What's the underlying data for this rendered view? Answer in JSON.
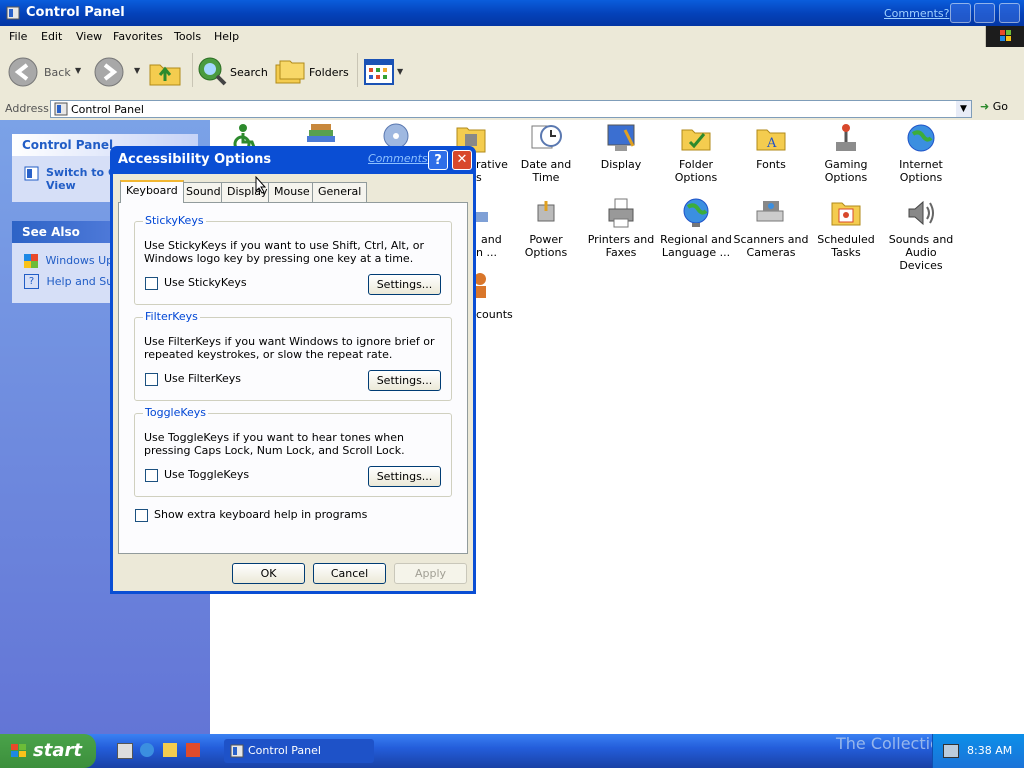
{
  "window": {
    "title": "Control Panel",
    "comments_link": "Comments?"
  },
  "menubar": [
    "File",
    "Edit",
    "View",
    "Favorites",
    "Tools",
    "Help"
  ],
  "toolbar": {
    "back": "Back",
    "search": "Search",
    "folders": "Folders"
  },
  "address": {
    "label": "Address",
    "value": "Control Panel",
    "go": "Go"
  },
  "left_panel": {
    "control_panel_title": "Control Panel",
    "switch_view": "Switch to Classic View",
    "switch_view_visible": [
      "Switch to C",
      "View"
    ],
    "see_also_title": "See Also",
    "see_also_items": [
      "Windows Upd",
      "Help and Sup"
    ]
  },
  "content_items": [
    {
      "label": "Date and Time",
      "icon": "clock-icon"
    },
    {
      "label": "Display",
      "icon": "display-icon"
    },
    {
      "label": "Folder Options",
      "icon": "folder-icon"
    },
    {
      "label": "Fonts",
      "icon": "fonts-folder-icon"
    },
    {
      "label": "Gaming Options",
      "icon": "joystick-icon"
    },
    {
      "label": "Internet Options",
      "icon": "globe-icon"
    },
    {
      "label": "Power Options",
      "icon": "power-icon"
    },
    {
      "label": "Printers and Faxes",
      "icon": "printer-icon"
    },
    {
      "label": "Regional and Language ...",
      "icon": "globe-icon"
    },
    {
      "label": "Scanners and Cameras",
      "icon": "scanner-icon"
    },
    {
      "label": "Scheduled Tasks",
      "icon": "calendar-icon"
    },
    {
      "label": "Sounds and Audio Devices",
      "icon": "speaker-icon"
    }
  ],
  "partial_items": [
    "rative",
    "s",
    "and",
    "n ...",
    "counts"
  ],
  "dialog": {
    "title": "Accessibility Options",
    "comments_link": "Comments?",
    "help_glyph": "?",
    "close_glyph": "✕",
    "tabs": [
      "Keyboard",
      "Sound",
      "Display",
      "Mouse",
      "General"
    ],
    "active_tab": "Keyboard",
    "groups": [
      {
        "title": "StickyKeys",
        "description": "Use StickyKeys if you want to use Shift, Ctrl, Alt, or Windows logo key by pressing one key at a time.",
        "checkbox": "Use StickyKeys",
        "checked": false,
        "button": "Settings..."
      },
      {
        "title": "FilterKeys",
        "description": "Use FilterKeys if you want Windows to ignore brief or repeated keystrokes, or slow the repeat rate.",
        "checkbox": "Use FilterKeys",
        "checked": false,
        "button": "Settings..."
      },
      {
        "title": "ToggleKeys",
        "description": "Use ToggleKeys if you want to hear tones when pressing Caps Lock, Num Lock, and Scroll Lock.",
        "checkbox": "Use ToggleKeys",
        "checked": false,
        "button": "Settings..."
      }
    ],
    "extra_help_checkbox": "Show extra keyboard help in programs",
    "buttons": {
      "ok": "OK",
      "cancel": "Cancel",
      "apply": "Apply"
    }
  },
  "taskbar": {
    "start": "start",
    "task": "Control Panel",
    "clock": "8:38 AM",
    "watermark": "The Collection Book"
  },
  "colors": {
    "title_blue": "#0441b8",
    "dialog_blue": "#0a4ed4",
    "panel_blue": "#6f8ce0",
    "start_green": "#3c8f3c",
    "close_red": "#d8482b"
  }
}
